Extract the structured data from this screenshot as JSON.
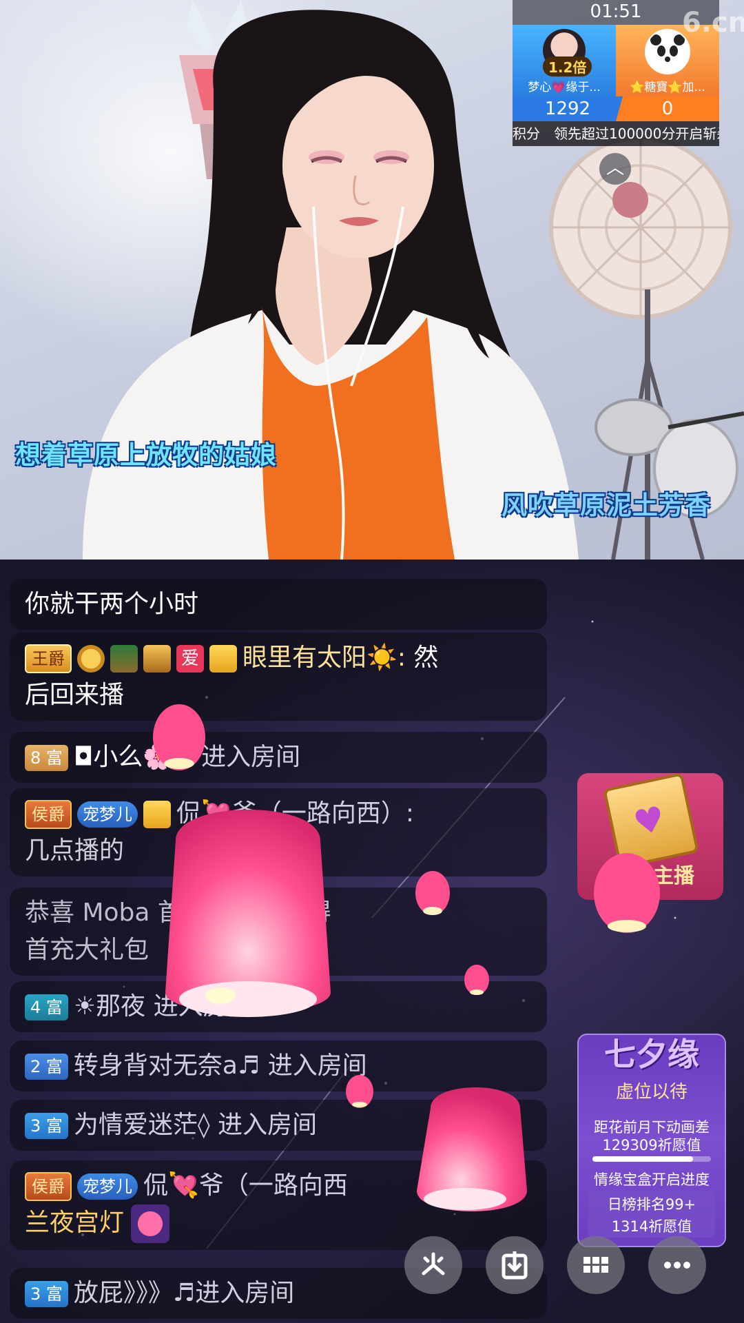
{
  "video": {
    "subtitle_left": "想着草原上放牧的姑娘",
    "subtitle_right": "风吹草原泥土芳香"
  },
  "pk": {
    "timer": "01:51",
    "left_multiplier": "1.2倍",
    "left_name": "梦心💗缘于...",
    "right_name": "⭐糖寶⭐加...",
    "left_score": "1292",
    "right_score": "0",
    "ticker": "积分　领先超过100000分开启斩杀",
    "logo": "6.cn"
  },
  "chat": [
    {
      "text": "你就干两个小时"
    },
    {
      "badges": [
        "王爵"
      ],
      "name": "眼里有太阳☀️:",
      "text1": " 然",
      "text2": "后回来播"
    },
    {
      "level": "8 富",
      "name": "◘小么🌸◘",
      "action": " 进入房间"
    },
    {
      "noble": "侯爵",
      "fan": "宠梦儿",
      "name": "侃💘爷（一路向西）:",
      "text": "几点播的"
    },
    {
      "text": "恭喜 Moba 首充活动中获得",
      "text2": "首充大礼包"
    },
    {
      "level": "4 富",
      "name": "☀那夜",
      "action": " 进入房间"
    },
    {
      "level": "2 富",
      "name": "转身背对无奈a♬",
      "action": " 进入房间"
    },
    {
      "level": "3 富",
      "name": "为情爱迷茫◊",
      "action": " 进入房间"
    },
    {
      "noble": "侯爵",
      "fan": "宠梦儿",
      "name": "侃💘爷（一路向西",
      "text": "兰夜宫灯"
    },
    {
      "level": "3 富",
      "name": "放屁》》》♬",
      "action": "进入房间"
    }
  ],
  "widgets": {
    "card_label": "主播",
    "qixi_title": "七夕缘",
    "qixi_sub": "虚位以待",
    "qixi_l1": "距花前月下动画差",
    "qixi_l2": "129309祈愿值",
    "qixi_progress": 0.85,
    "qixi_l3": "情缘宝盒开启进度",
    "qixi_l4": "日榜排名99+",
    "qixi_l5": "1314祈愿值"
  },
  "icons": {
    "share": "share-icon",
    "download": "download-icon",
    "grid": "grid-icon",
    "more": "more-icon"
  },
  "colors": {
    "subtitle": "#6fe3ff",
    "pk_blue": "#2c7be5",
    "pk_orange": "#ff7f20",
    "lantern": "#ff4f8e"
  }
}
